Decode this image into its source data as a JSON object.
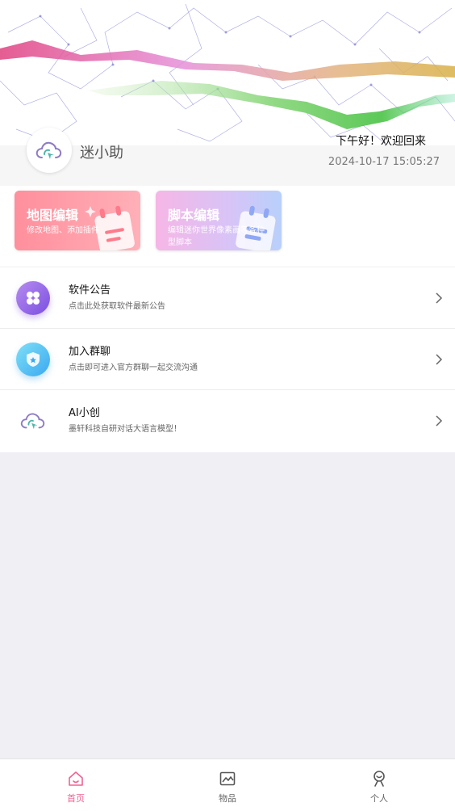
{
  "header": {
    "app_name": "迷小助",
    "greeting": "下午好！欢迎回来",
    "datetime": "2024-10-17 15:05:27"
  },
  "cards": [
    {
      "title": "地图编辑",
      "subtitle": "修改地图、添加插件",
      "color": "#ff8f9c"
    },
    {
      "title": "脚本编辑",
      "subtitle": "编辑迷你世界像素画等各种型脚本",
      "color": "#d7c4f7"
    }
  ],
  "list": [
    {
      "title": "软件公告",
      "subtitle": "点击此处获取软件最新公告",
      "icon": "clover-icon",
      "color": "#8a5ce6"
    },
    {
      "title": "加入群聊",
      "subtitle": "点击即可进入官方群聊一起交流沟通",
      "icon": "shield-icon",
      "color": "#3aa8f0"
    },
    {
      "title": "AI小创",
      "subtitle": "墨轩科技自研对话大语言模型！",
      "icon": "cloud-icon",
      "color": "#8888aa"
    }
  ],
  "tabs": [
    {
      "label": "首页",
      "icon": "home-icon",
      "active": true
    },
    {
      "label": "物品",
      "icon": "image-icon",
      "active": false
    },
    {
      "label": "个人",
      "icon": "person-icon",
      "active": false
    }
  ],
  "colors": {
    "accent": "#f06292",
    "background": "#efeff4"
  }
}
